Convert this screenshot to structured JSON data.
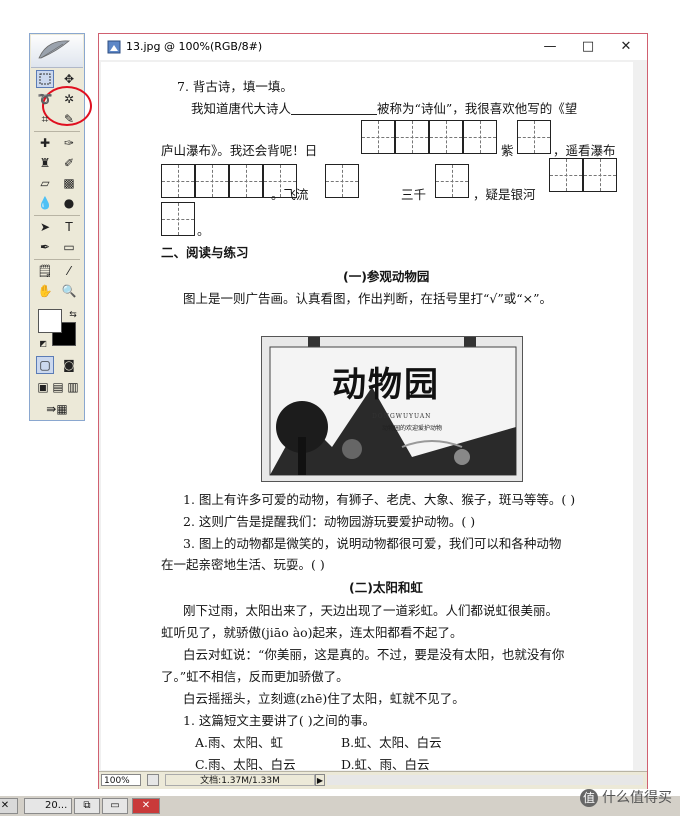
{
  "document_window": {
    "title": "13.jpg @ 100%(RGB/8#)",
    "minimize": "—",
    "maximize": "□",
    "close": "✕",
    "status": {
      "zoom": "100%",
      "doc_size": "文档:1.37M/1.33M",
      "arrow": "▶"
    }
  },
  "page": {
    "q7_title": "7. 背古诗，填一填。",
    "q7_line1_a": "我知道唐代大诗人",
    "q7_line1_b": "被称为“诗仙”，我很喜欢他写的《望",
    "q7_line2_a": "庐山瀑布》。我还会背呢！日",
    "q7_line2_b": "紫",
    "q7_line2_c": "，遥看瀑布",
    "q7_line3_a": "。飞流",
    "q7_line3_b": "三千",
    "q7_line3_c": "，疑是银河",
    "q7_line4": "。",
    "section2": "二、阅读与练习",
    "sub1": "(一)参观动物园",
    "instr": "图上是一则广告画。认真看图，作出判断，在括号里打“√”或“×”。",
    "poster": {
      "title": "动物园",
      "sub": "DONGWUYUAN",
      "note": "动物园的欢迎爱护动物"
    },
    "s1": "1. 图上有许多可爱的动物，有狮子、老虎、大象、猴子，斑马等等。(   )",
    "s2": "2. 这则广告是提醒我们：动物园游玩要爱护动物。(   )",
    "s3a": "3. 图上的动物都是微笑的，说明动物都很可爱，我们可以和各种动物",
    "s3b": "在一起亲密地生活、玩耍。(   )",
    "sub2": "(二)太阳和虹",
    "p1a": "刚下过雨，太阳出来了，天边出现了一道彩虹。人们都说虹很美丽。",
    "p1b": "虹听见了，就骄傲(jiāo ào)起来，连太阳都看不起了。",
    "p2a": "白云对虹说：“你美丽，这是真的。不过，要是没有太阳，也就没有你",
    "p2b": "了。”虹不相信，反而更加骄傲了。",
    "p3": "白云摇摇头，立刻遮(zhē)住了太阳，虹就不见了。",
    "q1": "1. 这篇短文主要讲了(      )之间的事。",
    "optA": "A.雨、太阳、虹",
    "optB": "B.虹、太阳、白云",
    "optC": "C.雨、太阳、白云",
    "optD": "D.虹、雨、白云"
  },
  "taskbar": {
    "task_label": "20...",
    "close_label": "✕"
  },
  "watermark": {
    "logo": "值",
    "text": "什么值得买"
  }
}
